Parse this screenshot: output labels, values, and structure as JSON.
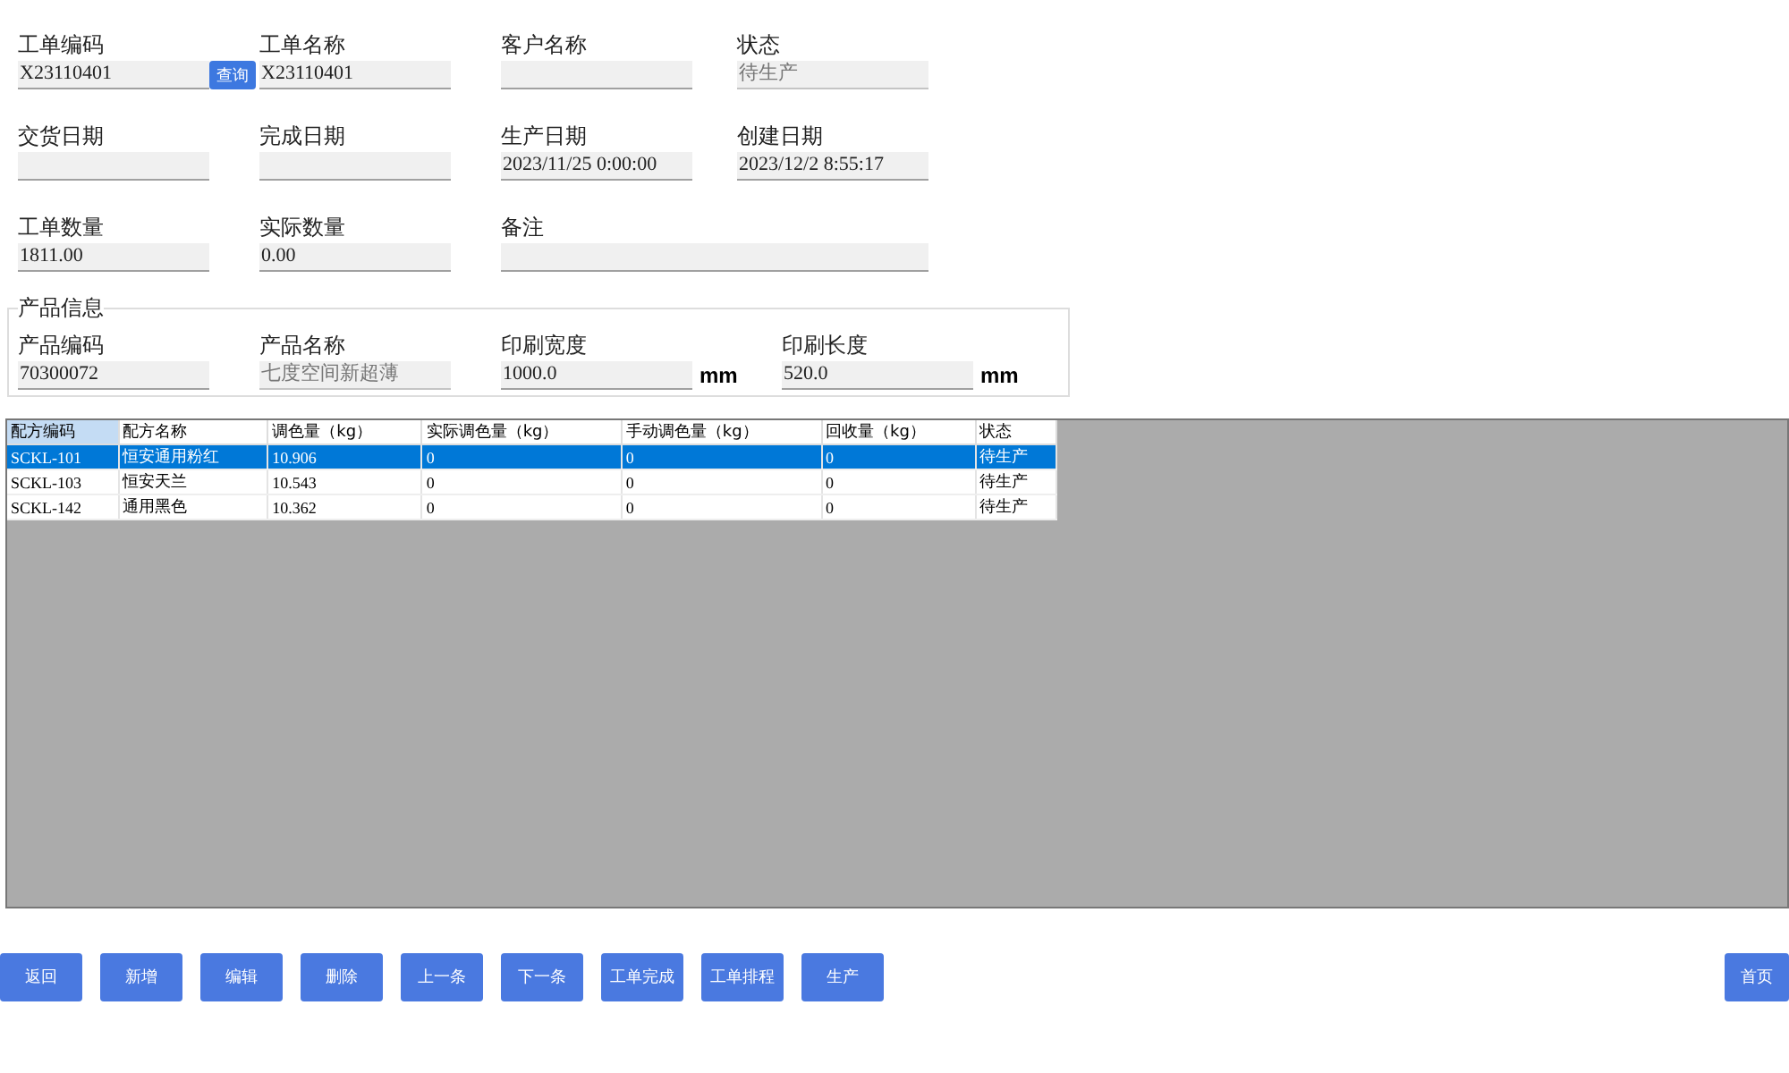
{
  "order_fields": [
    {
      "label": "工单编码",
      "value": "X23110401",
      "disabled": false,
      "wide": false,
      "button": "查询"
    },
    {
      "label": "工单名称",
      "value": "X23110401",
      "disabled": false,
      "wide": false
    },
    {
      "label": "客户名称",
      "disabled": false,
      "wide": false
    },
    {
      "label": "状态",
      "value": "待生产",
      "disabled": true,
      "wide": false
    },
    {
      "label": "交货日期",
      "disabled": false,
      "wide": false
    },
    {
      "label": "完成日期",
      "disabled": false,
      "wide": false
    },
    {
      "label": "生产日期",
      "value": "2023/11/25 0:00:00",
      "disabled": false,
      "wide": false
    },
    {
      "label": "创建日期",
      "value": "2023/12/2 8:55:17",
      "disabled": false,
      "wide": false
    },
    {
      "label": "工单数量",
      "value": "1811.00",
      "disabled": false,
      "wide": false
    },
    {
      "label": "实际数量",
      "value": "0.00",
      "disabled": false,
      "wide": false
    },
    {
      "label": "备注",
      "disabled": false,
      "wide": true
    }
  ],
  "product_info": {
    "title": "产品信息",
    "fields": [
      {
        "label": "产品编码",
        "value": "70300072",
        "disabled": false
      },
      {
        "label": "产品名称",
        "value": "七度空间新超薄",
        "disabled": true
      },
      {
        "label": "印刷宽度",
        "value": "1000.0",
        "disabled": false,
        "unit": "mm"
      },
      {
        "label": "印刷长度",
        "value": "520.0",
        "disabled": false,
        "unit": "mm"
      }
    ]
  },
  "table": {
    "columns": [
      {
        "label": "配方编码",
        "selected": true
      },
      {
        "label": "配方名称",
        "selected": false
      },
      {
        "label": "调色量（kg）",
        "selected": false
      },
      {
        "label": "实际调色量（kg）",
        "selected": false
      },
      {
        "label": "手动调色量（kg）",
        "selected": false
      },
      {
        "label": "回收量（kg）",
        "selected": false
      },
      {
        "label": "状态",
        "selected": false
      }
    ],
    "rows": [
      {
        "selected": true,
        "cells": [
          "SCKL-101",
          "恒安通用粉红",
          "10.906",
          "0",
          "0",
          "0",
          "待生产"
        ]
      },
      {
        "selected": false,
        "cells": [
          "SCKL-103",
          "恒安天兰",
          "10.543",
          "0",
          "0",
          "0",
          "待生产"
        ]
      },
      {
        "selected": false,
        "cells": [
          "SCKL-142",
          "通用黑色",
          "10.362",
          "0",
          "0",
          "0",
          "待生产"
        ]
      }
    ]
  },
  "buttons": [
    "返回",
    "新增",
    "编辑",
    "删除",
    "上一条",
    "下一条",
    "工单完成",
    "工单排程",
    "生产"
  ],
  "home_button": "首页"
}
